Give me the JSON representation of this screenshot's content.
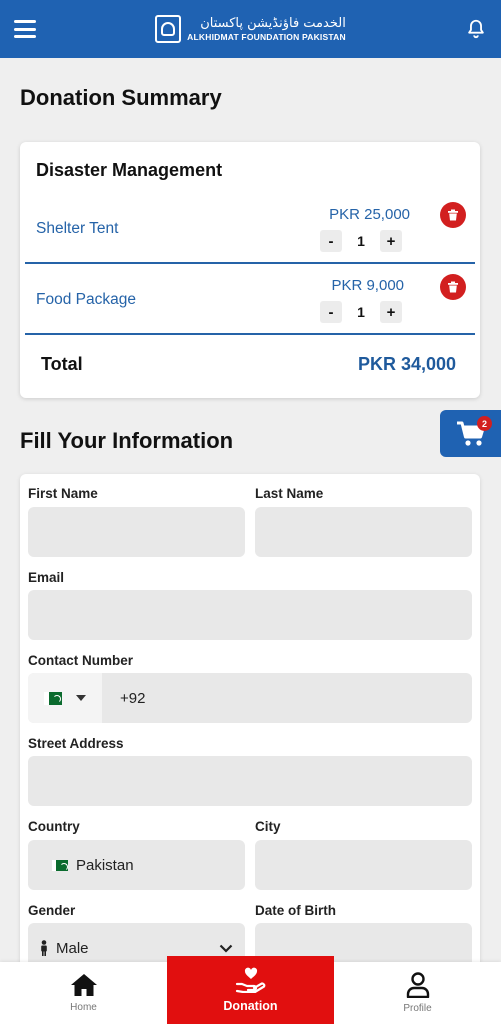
{
  "header": {
    "brand_urdu": "الخدمت فاؤنڈیشن پاکستان",
    "brand_english": "ALKHIDMAT FOUNDATION PAKISTAN"
  },
  "summary": {
    "title": "Donation Summary",
    "category": "Disaster Management",
    "items": [
      {
        "name": "Shelter Tent",
        "price": "PKR 25,000",
        "quantity": "1",
        "minus": "-",
        "plus": "+"
      },
      {
        "name": "Food Package",
        "price": "PKR 9,000",
        "quantity": "1",
        "minus": "-",
        "plus": "+"
      }
    ],
    "total_label": "Total",
    "total_value": "PKR 34,000"
  },
  "cart": {
    "badge_count": "2"
  },
  "form": {
    "title": "Fill Your Information",
    "first_name_label": "First Name",
    "last_name_label": "Last Name",
    "email_label": "Email",
    "contact_label": "Contact Number",
    "phone_code": "+92",
    "street_label": "Street Address",
    "country_label": "Country",
    "country_value": "Pakistan",
    "city_label": "City",
    "gender_label": "Gender",
    "gender_value": "Male",
    "dob_label": "Date of Birth"
  },
  "nav": {
    "home": "Home",
    "donation": "Donation",
    "profile": "Profile"
  },
  "colors": {
    "primary_blue": "#1f62b2",
    "accent_red": "#e10f0f",
    "link_blue": "#2563a8"
  }
}
